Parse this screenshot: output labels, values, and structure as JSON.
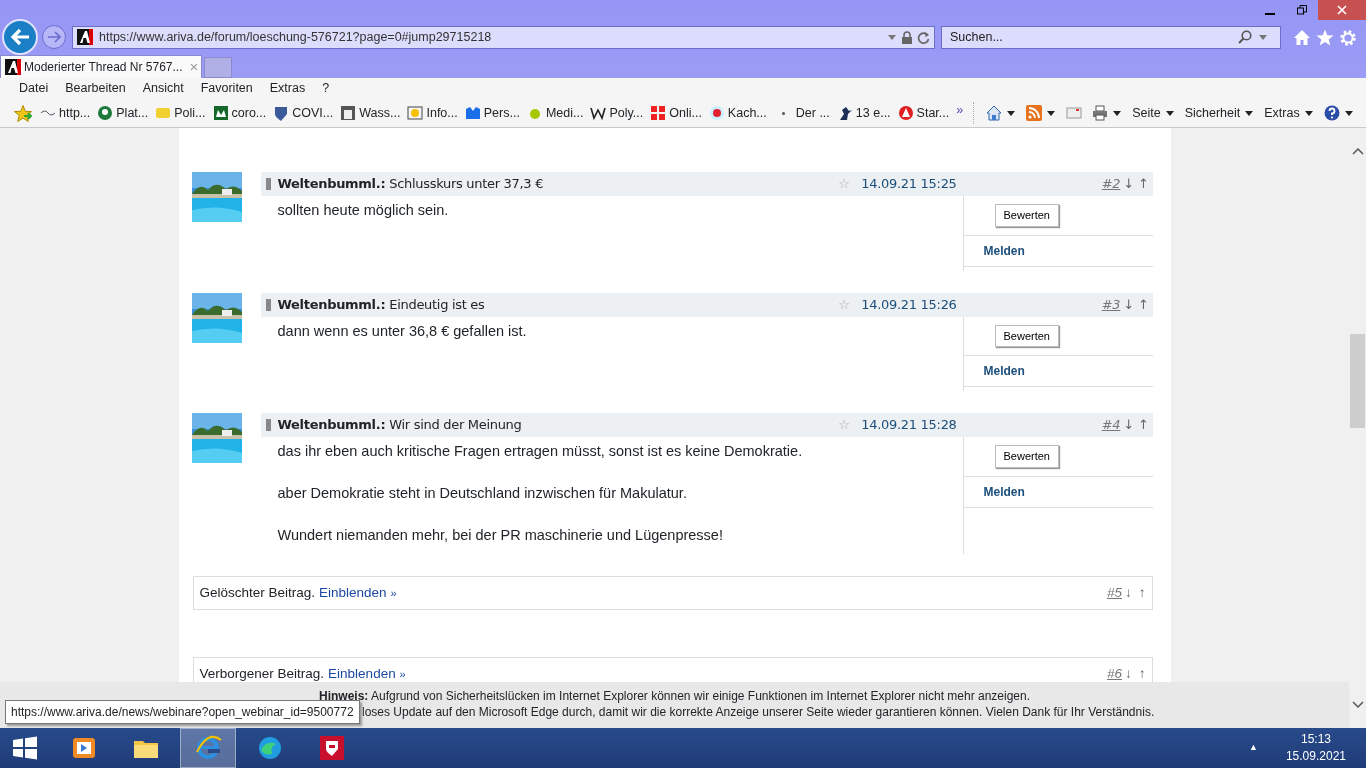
{
  "browser": {
    "address": "https://www.ariva.de/forum/loeschung-576721?page=0#jump29715218",
    "search": {
      "placeholder": "Suchen..."
    },
    "tabs": [
      {
        "label": "Moderierter Thread Nr 5767...",
        "close": "×",
        "selected": true
      }
    ],
    "menu": [
      "Datei",
      "Bearbeiten",
      "Ansicht",
      "Favoriten",
      "Extras",
      "?"
    ],
    "favorites": [
      "http...",
      "Plat...",
      "Poli...",
      "coro...",
      "COVI...",
      "Wass...",
      "Info...",
      "Pers...",
      "Medi...",
      "Poly...",
      "Onli...",
      "Kach...",
      "Der ...",
      "13 e...",
      "Star..."
    ],
    "more": "»",
    "commands": [
      "Seite",
      "Sicherheit",
      "Extras"
    ]
  },
  "posts": [
    {
      "kind": "post",
      "author": "Weltenbumml.:",
      "subject": "Schlusskurs unter 37,3 €",
      "star": "☆",
      "date": "14.09.21 15:25",
      "number": "#2",
      "down": "↓",
      "up": "↑",
      "body": [
        "sollten heute möglich sein."
      ],
      "rate": "Bewerten",
      "report": "Melden"
    },
    {
      "kind": "post",
      "author": "Weltenbumml.:",
      "subject": "Eindeutig ist es",
      "star": "☆",
      "date": "14.09.21 15:26",
      "number": "#3",
      "down": "↓",
      "up": "↑",
      "body": [
        "dann wenn es unter 36,8 € gefallen ist."
      ],
      "rate": "Bewerten",
      "report": "Melden"
    },
    {
      "kind": "post",
      "author": "Weltenbumml.:",
      "subject": "Wir sind der Meinung",
      "star": "☆",
      "date": "14.09.21 15:28",
      "number": "#4",
      "down": "↓",
      "up": "↑",
      "body": [
        "das ihr eben auch kritische Fragen ertragen müsst, sonst ist es keine Demokratie.",
        "aber Demokratie steht in Deutschland inzwischen für Makulatur.",
        "Wundert niemanden mehr, bei der PR  maschinerie und Lügenpresse!"
      ],
      "rate": "Bewerten",
      "report": "Melden"
    },
    {
      "kind": "collapsed",
      "label": "Gelöschter Beitrag.",
      "link": "Einblenden",
      "chevron": "»",
      "number": "#5",
      "down": "↓",
      "up": "↑"
    },
    {
      "kind": "collapsed",
      "label": "Verborgener Beitrag.",
      "link": "Einblenden",
      "chevron": "»",
      "number": "#6",
      "down": "↓",
      "up": "↑"
    }
  ],
  "notice": {
    "lead": "Hinweis:",
    "line_1": "Aufgrund von Sicherheitslücken im Internet Explorer können wir einige Funktionen im Internet Explorer nicht mehr anzeigen.",
    "line_2": "loses Update auf den Microsoft Edge durch, damit wir die korrekte Anzeige unserer Seite wieder garantieren können. Vielen Dank für Ihr Verständnis."
  },
  "status_tooltip": "https://www.ariva.de/news/webinare?open_webinar_id=9500772",
  "taskbar": {
    "apps": [
      {
        "selected": false
      },
      {
        "selected": false
      },
      {
        "selected": false
      },
      {
        "selected": true
      },
      {
        "selected": false
      },
      {
        "selected": false
      }
    ],
    "time": "15:13",
    "date": "15.09.2021",
    "tray": "▲"
  }
}
